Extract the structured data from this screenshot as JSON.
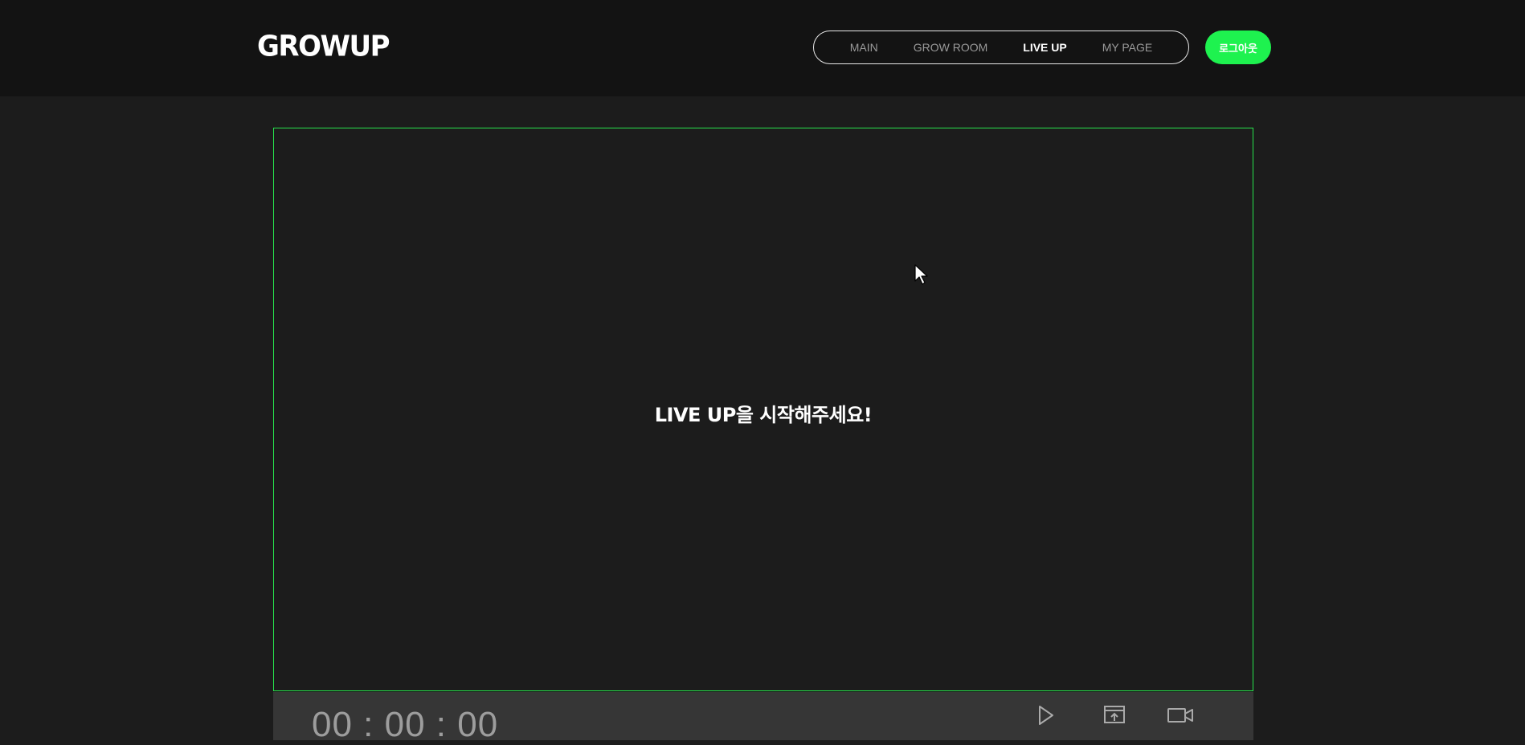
{
  "header": {
    "logo": "GROWUP",
    "nav": [
      {
        "label": "MAIN",
        "active": false
      },
      {
        "label": "GROW ROOM",
        "active": false
      },
      {
        "label": "LIVE UP",
        "active": true
      },
      {
        "label": "MY PAGE",
        "active": false
      }
    ],
    "logout_label": "로그아웃"
  },
  "stage": {
    "message": "LIVE UP을 시작해주세요!"
  },
  "controls": {
    "timer": "00 : 00 : 00",
    "icons": [
      "play-icon",
      "screen-share-icon",
      "camera-icon"
    ]
  },
  "colors": {
    "accent": "#1ef24f",
    "stage_border": "#27e34c",
    "header_bg": "#131313",
    "page_bg": "#1c1c1c",
    "control_bg": "#363636"
  }
}
